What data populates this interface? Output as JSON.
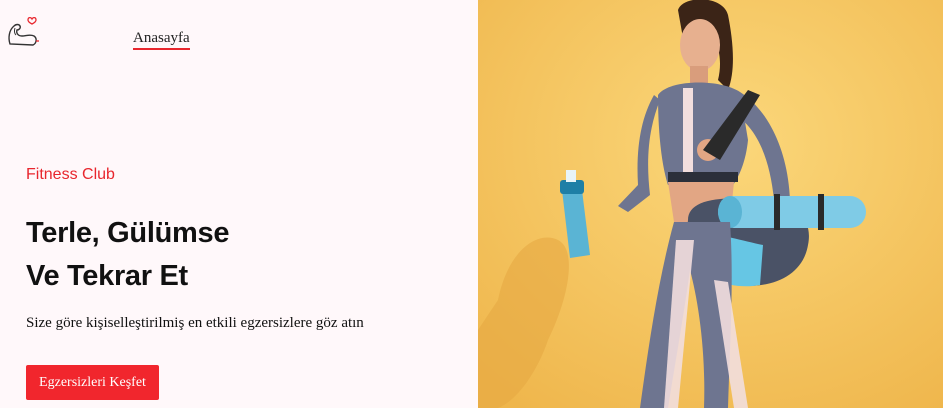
{
  "nav": {
    "logo_icon": "flexed-arm-heart-icon",
    "home_label": "Anasayfa"
  },
  "hero": {
    "tagline": "Fitness Club",
    "headline_line1": "Terle, Gülümse",
    "headline_line2": "Ve Tekrar Et",
    "description": "Size göre kişiselleştirilmiş en etkili egzersizlere göz atın",
    "cta_label": "Egzersizleri Keşfet"
  },
  "colors": {
    "accent": "#f1262d",
    "background": "#fff8fa",
    "hero_background": "#f5c35b"
  }
}
